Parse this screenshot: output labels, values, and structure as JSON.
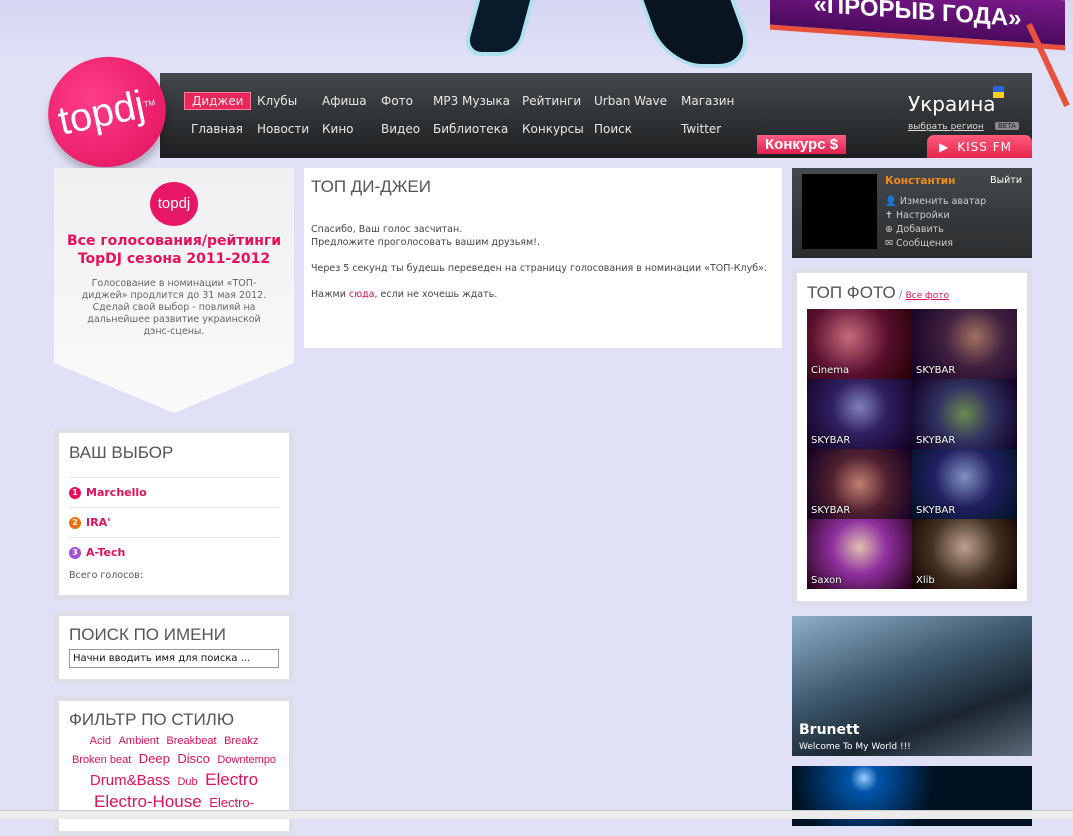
{
  "banner": {
    "promo_text": "«ПРОРЫВ ГОДА»"
  },
  "logo": {
    "text": "topdj",
    "tm": "TM"
  },
  "nav": {
    "row1": [
      "Диджеи",
      "Клубы",
      "Афиша",
      "Фото",
      "MP3 Музыка",
      "Рейтинги",
      "Urban Wave",
      "Магазин"
    ],
    "row2": [
      "Главная",
      "Новости",
      "Кино",
      "Видео",
      "Библиотека",
      "Конкурсы",
      "Поиск",
      "Twitter"
    ],
    "active": "Диджеи",
    "region": "Украина",
    "region_link": "выбрать регион",
    "beta": "BETA",
    "contest": "Конкурс $",
    "radio": "KISS FM"
  },
  "promo": {
    "logo": "topdj",
    "title": "Все голосования/рейтинги TopDJ сезона 2011-2012",
    "text": "Голосование в номинации «ТОП-диджей» продлится до 31 мая 2012. Сделай свой выбор - повлияй на дальнейшее развитие украинской дэнс-сцены."
  },
  "choice": {
    "title": "ВАШ ВЫБОР",
    "items": [
      {
        "n": "1",
        "name": "Marchello",
        "color": "#e8105a"
      },
      {
        "n": "2",
        "name": "IRA'",
        "color": "#f07010"
      },
      {
        "n": "3",
        "name": "A-Tech",
        "color": "#a050d8"
      }
    ],
    "total": "Всего голосов:"
  },
  "search": {
    "title": "ПОИСК ПО ИМЕНИ",
    "value": "Начни вводить имя для поиска ..."
  },
  "filter": {
    "title": "ФИЛЬТР ПО СТИЛЮ",
    "tags": [
      "Acid",
      "Ambient",
      "Breakbeat",
      "Breakz",
      "Broken beat",
      "Deep",
      "Disco",
      "Downtempo",
      "Drum&Bass",
      "Dub",
      "Electro",
      "Electro-House",
      "Electro-"
    ]
  },
  "content": {
    "title": "ТОП ДИ-ДЖЕИ",
    "line1": "Спасибо, Ваш голос засчитан.",
    "line2": "Предложите проголосовать вашим друзьям!.",
    "line3": "Через 5 секунд ты будешь переведен на страницу голосования в номинации «ТОП-Клуб».",
    "pre": "Нажми ",
    "link": "сюда",
    "post": ", если не хочешь ждать."
  },
  "user": {
    "name": "Константин",
    "logout": "Выйти",
    "menu": [
      "Изменить аватар",
      "Настройки",
      "Добавить",
      "Сообщения"
    ]
  },
  "photos": {
    "title": "ТОП ФОТО",
    "sep": "/",
    "all": "Все фото",
    "items": [
      "Cinema",
      "SKYBAR",
      "SKYBAR",
      "SKYBAR",
      "SKYBAR",
      "SKYBAR",
      "Saxon",
      "Xlib"
    ]
  },
  "feature": {
    "name": "Brunett",
    "subtitle": "Welcome To My World !!!"
  }
}
